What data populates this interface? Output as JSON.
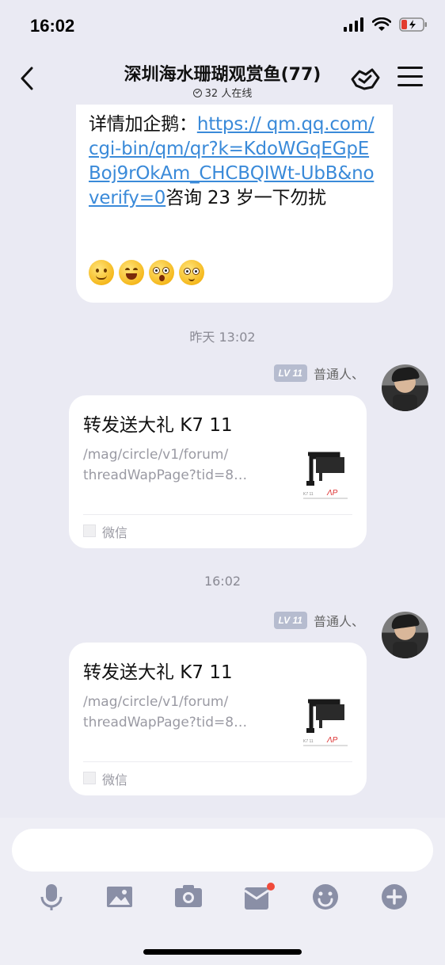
{
  "status_bar": {
    "time": "16:02"
  },
  "header": {
    "title": "深圳海水珊瑚观赏鱼(77)",
    "online": "32 人在线"
  },
  "messages": {
    "first": {
      "text_before": "详情加企鹅：",
      "link": "https:// qm.qq.com/cgi-bin/qm/qr?k=KdoWGqEGpEBoj9rOkAm_CHCBQIWt-UbB&noverify=0",
      "text_after": "咨询 23 岁一下勿扰"
    },
    "timestamp_1": "昨天 13:02",
    "timestamp_2": "16:02",
    "card_1": {
      "level": "LV 11",
      "sender": "普通人、",
      "title": "转发送大礼 K7 11",
      "desc": "/mag/circle/v1/forum/ threadWapPage?tid=8…",
      "source": "微信"
    },
    "card_2": {
      "level": "LV 11",
      "sender": "普通人、",
      "title": "转发送大礼 K7 11",
      "desc": "/mag/circle/v1/forum/ threadWapPage?tid=8…",
      "source": "微信"
    }
  },
  "input": {
    "placeholder": ""
  },
  "toolbar": {
    "icons": [
      "microphone-icon",
      "image-icon",
      "camera-icon",
      "red-packet-icon",
      "emoji-icon",
      "plus-icon"
    ]
  },
  "colors": {
    "accent_link": "#3a8ad9",
    "notification_dot": "#f04a3a"
  }
}
